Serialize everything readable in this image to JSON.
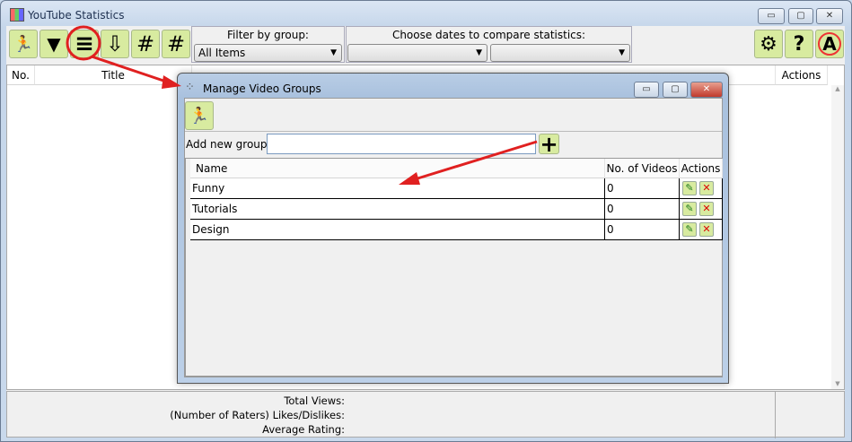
{
  "window": {
    "title": "YouTube Statistics",
    "min": "▭",
    "max": "▢",
    "close": "✕"
  },
  "toolbar": {
    "buttons": [
      {
        "name": "run-icon",
        "glyph": "🏃"
      },
      {
        "name": "filter-icon",
        "glyph": "▼"
      },
      {
        "name": "groups-icon",
        "glyph": "≡"
      },
      {
        "name": "down-arrow-icon",
        "glyph": "⇩"
      },
      {
        "name": "hash-icon",
        "glyph": "#"
      },
      {
        "name": "hash-alt-icon",
        "glyph": "#"
      }
    ],
    "settings": "⚙",
    "help": "?",
    "about": "A"
  },
  "filter": {
    "label": "Filter by group:",
    "value": "All Items"
  },
  "dates": {
    "label": "Choose dates to compare statistics:",
    "from": "",
    "to": ""
  },
  "table": {
    "columns": {
      "no": "No.",
      "title": "Title",
      "actions": "Actions"
    }
  },
  "footer": {
    "total_views": "Total Views:",
    "likes": "(Number of Raters) Likes/Dislikes:",
    "rating": "Average Rating:"
  },
  "dialog": {
    "title": "Manage Video Groups",
    "add_label": "Add new group:",
    "add_value": "",
    "add_btn": "+",
    "columns": {
      "name": "Name",
      "videos": "No. of Videos",
      "actions": "Actions"
    },
    "rows": [
      {
        "name": "Funny",
        "videos": "0"
      },
      {
        "name": "Tutorials",
        "videos": "0"
      },
      {
        "name": "Design",
        "videos": "0"
      }
    ],
    "edit": "✎",
    "delete": "✕"
  },
  "colors": {
    "accent_button": "#d8eba0",
    "annotation": "#e02020"
  }
}
